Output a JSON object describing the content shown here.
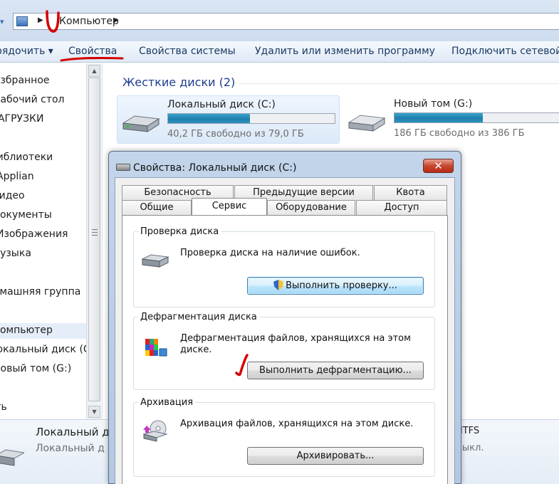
{
  "address": {
    "crumb": "Компьютер"
  },
  "toolbar": {
    "items": [
      "рядочить ▾",
      "Свойства",
      "Свойства системы",
      "Удалить или изменить программу",
      "Подключить сетевой д"
    ]
  },
  "navpane": {
    "items": [
      "Избранное",
      "Рабочий стол",
      "ЗАГРУЗКИ",
      "Библиотеки",
      "Applian",
      "Видео",
      "Документы",
      "Изображения",
      "Музыка",
      "Домашняя группа",
      "Компьютер",
      "Локальный диск (C:)",
      "Новый том (G:)",
      "Сеть"
    ]
  },
  "main": {
    "group_title": "Жесткие диски (2)",
    "drives": [
      {
        "name": "Локальный диск (C:)",
        "free_text": "40,2 ГБ свободно из 79,0 ГБ",
        "used_fraction": 0.49
      },
      {
        "name": "Новый том (G:)",
        "free_text": "186 ГБ свободно из 386 ГБ",
        "used_fraction": 0.52
      }
    ]
  },
  "details": {
    "name": "Локальный д",
    "sub": "Локальный д",
    "right1": "NTFS",
    "right2": "Выкл."
  },
  "dialog": {
    "title": "Свойства: Локальный диск (C:)",
    "close_label": "✕",
    "tabs_row1": [
      "Безопасность",
      "Предыдущие версии",
      "Квота"
    ],
    "tabs_row2": [
      "Общие",
      "Сервис",
      "Оборудование",
      "Доступ"
    ],
    "active_tab": "Сервис",
    "sections": {
      "check": {
        "title": "Проверка диска",
        "text": "Проверка диска на наличие ошибок.",
        "button": "Выполнить проверку..."
      },
      "defrag": {
        "title": "Дефрагментация диска",
        "text": "Дефрагментация файлов, хранящихся на этом диске.",
        "button": "Выполнить дефрагментацию..."
      },
      "backup": {
        "title": "Архивация",
        "text": "Архивация файлов, хранящихся на этом диске.",
        "button": "Архивировать..."
      }
    }
  },
  "colors": {
    "annotation": "#d40000",
    "accent": "#1e3d8f",
    "bar_fill": "#2b92c0"
  }
}
